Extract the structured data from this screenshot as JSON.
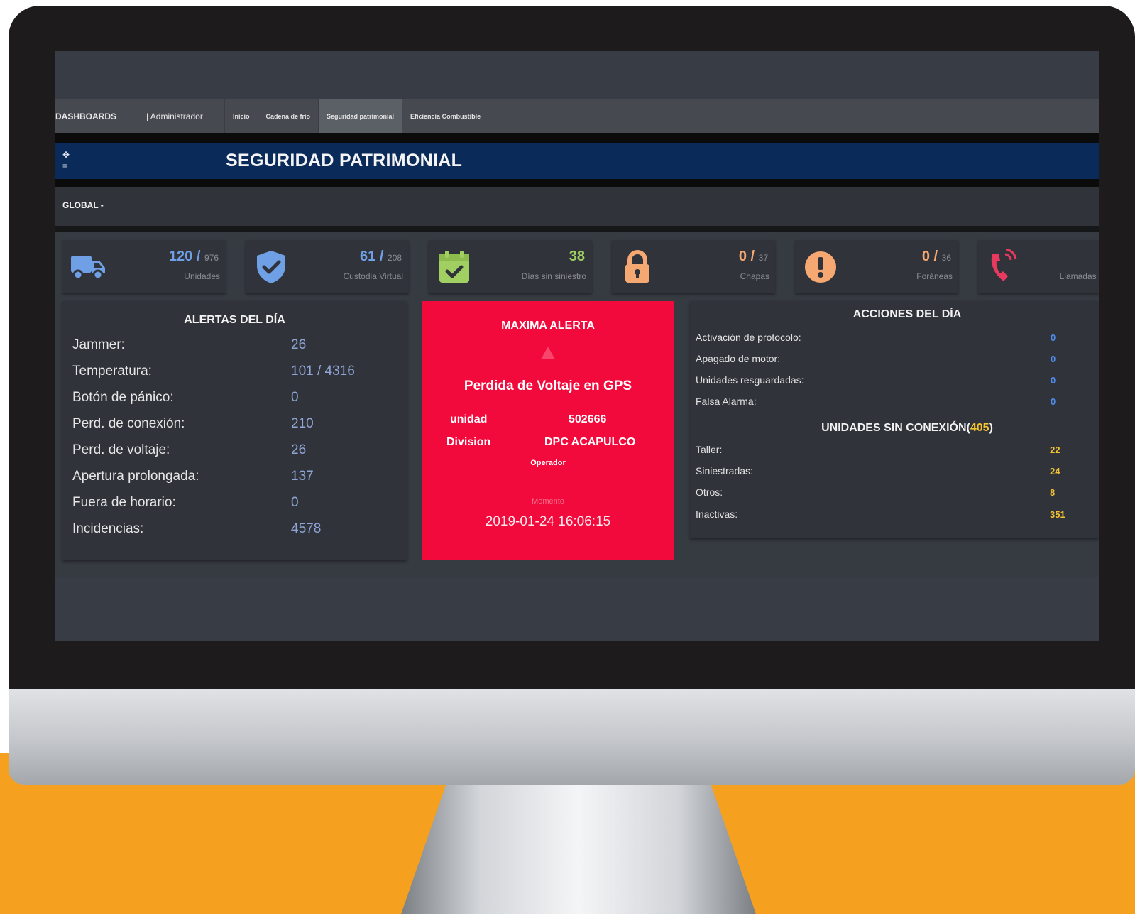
{
  "nav": {
    "brand": "DASHBOARDS",
    "user": "| Administrador",
    "items": [
      "Inicio",
      "Cadena de frio",
      "Seguridad patrimonial",
      "Eficiencia Combustible"
    ]
  },
  "title_icons": [
    "✥",
    "≡"
  ],
  "page_title": "SEGURIDAD PATRIMONIAL",
  "filter": {
    "label": "GLOBAL -"
  },
  "stats": [
    {
      "icon": "truck-icon",
      "value": "120 /",
      "total": "976",
      "label": "Unidades",
      "color": "#6fa0e6"
    },
    {
      "icon": "shield-check-icon",
      "value": "61 /",
      "total": "208",
      "label": "Custodia Virtual",
      "color": "#6fa0e6"
    },
    {
      "icon": "calendar-check-icon",
      "value": "38",
      "total": "",
      "label": "Días sin siniestro",
      "color": "#a2cf62"
    },
    {
      "icon": "lock-icon",
      "value": "0 /",
      "total": "37",
      "label": "Chapas",
      "color": "#f5a872"
    },
    {
      "icon": "exclamation-icon",
      "value": "0 /",
      "total": "36",
      "label": "Foráneas",
      "color": "#f5a872"
    },
    {
      "icon": "phone-ring-icon",
      "value": "",
      "total": "",
      "label": "Llamadas s",
      "color": "#e8395e"
    }
  ],
  "alertas": {
    "title": "ALERTAS DEL DÍA",
    "rows": [
      {
        "label": "Jammer:",
        "value": "26"
      },
      {
        "label": "Temperatura:",
        "value": "101 / 4316"
      },
      {
        "label": "Botón de pánico:",
        "value": "0"
      },
      {
        "label": "Perd. de conexión:",
        "value": "210"
      },
      {
        "label": "Perd. de voltaje:",
        "value": "26"
      },
      {
        "label": "Apertura prolongada:",
        "value": "137"
      },
      {
        "label": "Fuera de horario:",
        "value": "0"
      },
      {
        "label": "Incidencias:",
        "value": "4578"
      }
    ]
  },
  "maxima": {
    "title": "MAXIMA ALERTA",
    "alert": "Perdida de Voltaje en GPS",
    "unidad_label": "unidad",
    "unidad_value": "502666",
    "division_label": "Division",
    "division_value": "DPC ACAPULCO",
    "operador_label": "Operador",
    "momento_label": "Momento",
    "momento_value": "2019-01-24 16:06:15"
  },
  "acciones": {
    "title": "ACCIONES DEL DÍA",
    "rows": [
      {
        "label": "Activación de protocolo:",
        "value": "0"
      },
      {
        "label": "Apagado de motor:",
        "value": "0"
      },
      {
        "label": "Unidades resguardadas:",
        "value": "0"
      },
      {
        "label": "Falsa Alarma:",
        "value": "0"
      }
    ],
    "sin_title": "UNIDADES SIN CONEXIÓN(",
    "sin_count": "405",
    "sin_close": ")",
    "sin_rows": [
      {
        "label": "Taller:",
        "value": "22"
      },
      {
        "label": "Siniestradas:",
        "value": "24"
      },
      {
        "label": "Otros:",
        "value": "8"
      },
      {
        "label": "Inactivas:",
        "value": "351"
      }
    ]
  },
  "colors": {
    "title_bar": "#0a2b5a",
    "alert_red": "#f20a3c",
    "accent_blue": "#4f8df0",
    "accent_yellow": "#f5c430",
    "background_orange": "#f5a11f"
  }
}
